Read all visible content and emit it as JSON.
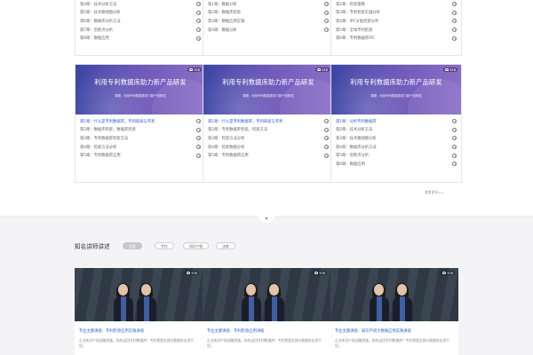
{
  "top_lists": [
    {
      "items": [
        "第4章：技术分析方法",
        "第5章：技术路线图分析",
        "第6章：数据库分析方法",
        "第7章：创新点分析",
        "第8章：数据应用"
      ]
    },
    {
      "items": [
        "第1章：数据分析",
        "第2章：数据库检索",
        "第3章：数据应用实践",
        "第4章：数据分析"
      ]
    },
    {
      "items": [
        "第2章：检索策略",
        "第3章：专利检索实操分析",
        "第4章：IPC分类检索分析",
        "第5章：全球专利检索",
        "第6章：专利数据库IPC"
      ]
    }
  ],
  "courses": [
    {
      "views": "356",
      "banner_title": "利用专利数据库助力新产品研发",
      "banner_sub": "课程：利用专利数据库助力新产品研发",
      "items": [
        "第1章：什么是专利数据库，专利研发与专利",
        "第2章：数据库检索，数据库检索",
        "第3章：专利数据库检索方法",
        "第4章：检索方法分析",
        "第5章：专利数据库应用"
      ]
    },
    {
      "views": "356",
      "banner_title": "利用专利数据库助力新产品研发",
      "banner_sub": "课程：利用专利数据库助力新产品研发",
      "items": [
        "第1章：什么是专利数据库，专利研发与专利",
        "第2章：专利数据库检索，检索方法",
        "第3章：检索方法分析",
        "第4章：检索数据分析",
        "第5章：专利数据库应用"
      ]
    },
    {
      "views": "356",
      "banner_title": "利用专利数据库助力新产品研发",
      "banner_sub": "课程：利用专利数据库助力新产品研发",
      "items": [
        "第1章：分析专利数据库",
        "第2章：技术分析方法",
        "第3章：技术路线图分析",
        "第4章：数据库分析方法",
        "第5章：创新点分析",
        "第6章：数据应用"
      ]
    }
  ],
  "more_link": "查看更多>>",
  "section": {
    "title": "知名讲师讲述",
    "tabs": [
      "全部",
      "专利",
      "知识产权",
      "法律"
    ]
  },
  "lecturers": [
    {
      "views": "356",
      "title": "专业主题讲座：专利检索应用实践讲座",
      "desc": "企业知识产权战略思路，如何运用专利数据库？专利检索实践与数据库应用介绍。"
    },
    {
      "views": "356",
      "title": "专业主题讲座：专利检索应用讲座",
      "desc": "企业知识产权战略思路，如何运用专利数据库？专利检索实践与数据库应用介绍。"
    },
    {
      "views": "356",
      "title": "专业主题讲座：知识产权大数据应用实践讲座",
      "desc": "企业知识产权战略思路，如何运用专利数据库？专利检索实践与数据库应用介绍。"
    }
  ],
  "icons": {
    "play": "play-circle-icon",
    "views": "eye-icon",
    "expand": "chevron-down-icon"
  },
  "colors": {
    "banner": "#5a50b0",
    "link": "#2c63c7",
    "tab_active": "#c8c8c8"
  }
}
